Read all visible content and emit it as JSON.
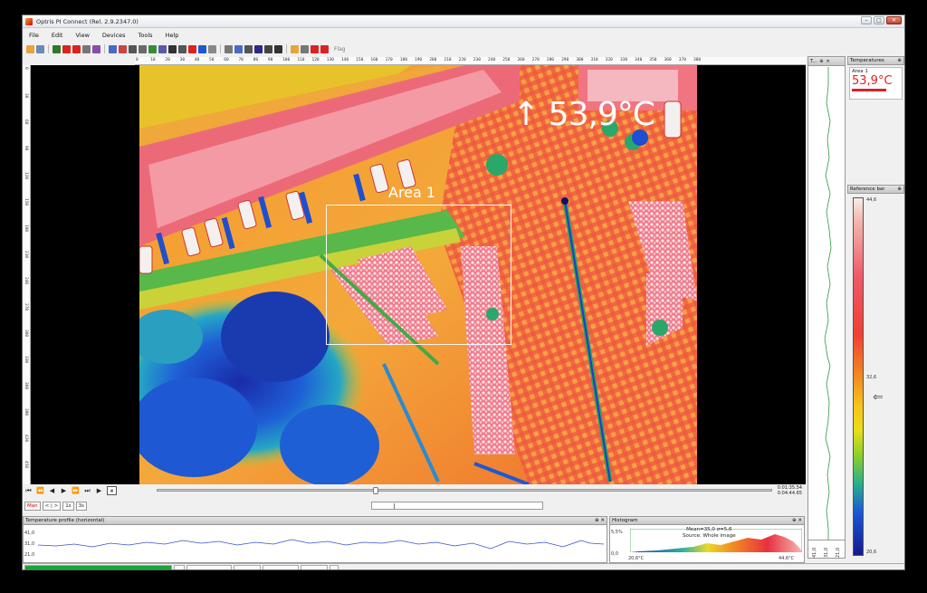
{
  "window": {
    "title": "Optris PI Connect (Rel. 2.9.2347.0)",
    "controls": [
      "–",
      "□",
      "✕"
    ]
  },
  "menu": [
    "File",
    "Edit",
    "View",
    "Devices",
    "Tools",
    "Help"
  ],
  "toolbar": {
    "icons": [
      "open-icon",
      "save-icon",
      "play-icon",
      "stop-icon",
      "record-icon",
      "snapshot-icon",
      "camera-icon",
      "copy-icon",
      "palette-icon",
      "table-icon",
      "chart-icon",
      "area-icon",
      "line-icon",
      "graph-icon",
      "measure-icon",
      "hotspot-icon",
      "coldspot-icon",
      "line-profile-icon",
      "focus-icon",
      "layout-icon",
      "grid-icon",
      "fullscreen-icon",
      "tools-icon",
      "settings-icon",
      "alarm-icon",
      "zoom-icon",
      "color-icon",
      "reference-icon"
    ],
    "flag_label": "Flag"
  },
  "ruler": {
    "top": [
      "0",
      "10",
      "20",
      "30",
      "40",
      "50",
      "60",
      "70",
      "80",
      "90",
      "100",
      "110",
      "120",
      "130",
      "140",
      "150",
      "160",
      "170",
      "180",
      "190",
      "200",
      "210",
      "220",
      "230",
      "240",
      "250",
      "260",
      "270",
      "280",
      "290",
      "300",
      "310",
      "320",
      "330",
      "340",
      "350",
      "360",
      "370",
      "380"
    ],
    "left": [
      "0",
      "30",
      "60",
      "90",
      "120",
      "150",
      "180",
      "210",
      "240",
      "270",
      "300",
      "330",
      "360",
      "390",
      "420",
      "450"
    ]
  },
  "overlay": {
    "max_temp": "↑ 53,9°C",
    "area_label": "Area 1"
  },
  "vertical_profile": {
    "header": "T...",
    "scale": [
      "41,0",
      "31,0",
      "21,0"
    ]
  },
  "temperatures_panel": {
    "title": "Temperatures",
    "area_name": "Area 1",
    "area_value": "53,9°C"
  },
  "reference_bar": {
    "title": "Reference bar",
    "top": "44,6",
    "mid": "32,6",
    "bottom": "20,6",
    "arrow": "⇐"
  },
  "playback": {
    "buttons": [
      "⏮",
      "⏪",
      "◀",
      "▶",
      "⏩",
      "⏭"
    ],
    "play": "▶",
    "pause": "⏸",
    "time_current": "0:01:35.54",
    "time_total": "0:04:44.65",
    "position_fraction": 0.35
  },
  "controls": {
    "man_label": "Man",
    "btn_a": "< | >",
    "btn_b": "1s",
    "btn_c": "3s"
  },
  "temp_profile": {
    "title": "Temperature profile (horizontal)",
    "y_labels": [
      "41,0",
      "31,0",
      "21,0"
    ]
  },
  "histogram": {
    "title": "Histogram",
    "stats_line1": "Mean=35,0 σ=5,6",
    "stats_line2": "Source:  Whole image",
    "y_top": "5,5%",
    "y_bottom": "0,0",
    "x_min": "20,6°C",
    "x_max": "44,6°C"
  },
  "colors": {
    "accent_red": "#e02020",
    "status_green": "#19a43a"
  }
}
